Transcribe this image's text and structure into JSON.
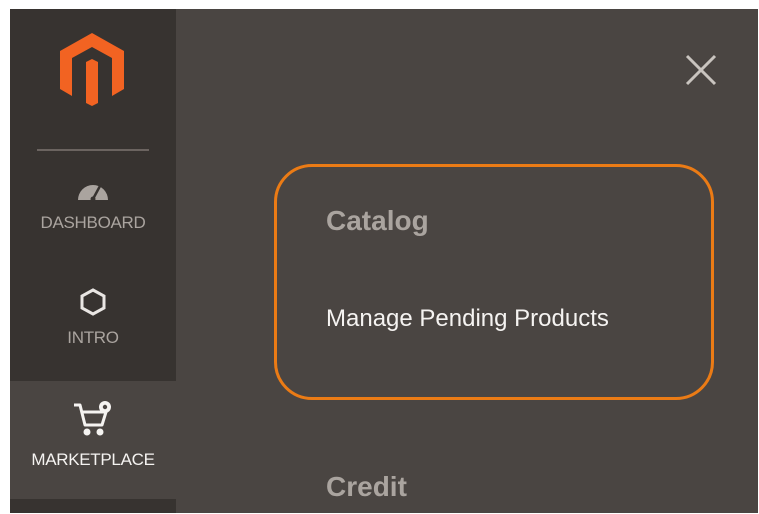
{
  "sidebar": {
    "logo_icon": "magento-logo-icon",
    "items": [
      {
        "label": "DASHBOARD",
        "icon": "dashboard-gauge-icon"
      },
      {
        "label": "INTRO",
        "icon": "hexagon-icon"
      },
      {
        "label": "MARKETPLACE",
        "icon": "cart-gear-icon",
        "active": true
      }
    ]
  },
  "menu": {
    "close_icon": "close-icon",
    "sections": [
      {
        "title": "Catalog",
        "links": [
          "Manage Pending Products"
        ]
      },
      {
        "title": "Credit",
        "links": []
      }
    ]
  },
  "colors": {
    "sidebar_bg": "#373330",
    "panel_bg": "#4a4542",
    "highlight_border": "#eb7b15",
    "logo_orange": "#f26322"
  }
}
